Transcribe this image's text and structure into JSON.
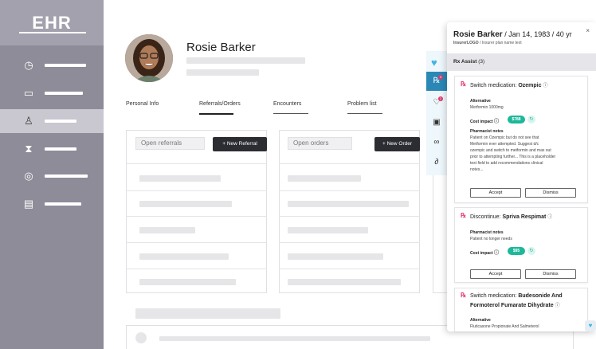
{
  "app": {
    "logo": "EHR"
  },
  "sidebar": {
    "items": [
      {
        "icon": "clock-icon",
        "glyph": "◷",
        "active": false
      },
      {
        "icon": "book-icon",
        "glyph": "▭",
        "active": false
      },
      {
        "icon": "person-icon",
        "glyph": "♙",
        "active": true
      },
      {
        "icon": "hourglass-icon",
        "glyph": "⧗",
        "active": false
      },
      {
        "icon": "location-icon",
        "glyph": "◎",
        "active": false
      },
      {
        "icon": "document-icon",
        "glyph": "▤",
        "active": false
      }
    ]
  },
  "patient": {
    "name": "Rosie Barker"
  },
  "tabs": [
    {
      "label": "Personal Info",
      "active": false
    },
    {
      "label": "Referrals/Orders",
      "active": true
    },
    {
      "label": "Encounters",
      "active": false
    },
    {
      "label": "Problem list",
      "active": false
    }
  ],
  "referrals": {
    "title": "Open referrals",
    "button": "+ New Referral"
  },
  "orders": {
    "title": "Open orders",
    "button": "+ New Order"
  },
  "drawer": {
    "patient_name": "Rosie Barker",
    "dob": "/ Jan 14, 1983 / 40 yr",
    "insurer_logo": "InsurerLOGO",
    "insurer_text": "/ Insurer plan name text",
    "close": "×",
    "section": "Rx Assist",
    "section_count": "(3)"
  },
  "cards": [
    {
      "action": "Switch medication:",
      "drug": "Ozempic",
      "alt_label": "Alternative",
      "alt_value": "Metformin 1000mg",
      "cost_label": "Cost impact",
      "cost": "$788",
      "notes_label": "Pharmacist notes",
      "notes": [
        "Patient on Ozempic but do not see that",
        "Metformin ever attempted.  Suggest d/c",
        "ozempic and switch to metformin and max out",
        "prior to attempting further... This is a placeholder",
        "text field to add recommendations clinical",
        "notes..."
      ],
      "accept": "Accept",
      "dismiss": "Dismiss"
    },
    {
      "action": "Discontinue:",
      "drug": "Spriva Respimat",
      "notes_label": "Pharmacist notes",
      "notes": [
        "Patient no longer needs"
      ],
      "cost_label": "Cost impact",
      "cost": "$95",
      "accept": "Accept",
      "dismiss": "Dismiss"
    },
    {
      "action": "Switch medication:",
      "drug": "Budesonide And",
      "drug2": "Formoterol Fumarate Dihydrate",
      "alt_label": "Alternative",
      "alt_value": "Fluticasone Propionate And Salmeterol"
    }
  ],
  "colors": {
    "sidebar": "#8e8c99",
    "accent": "#2b87b5",
    "rx": "#e0386f",
    "cost": "#1db89a"
  }
}
